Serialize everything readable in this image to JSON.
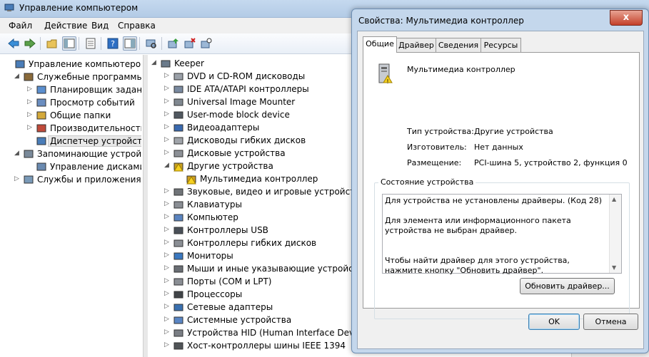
{
  "window": {
    "title": "Управление компьютером"
  },
  "menu": [
    "Файл",
    "Действие",
    "Вид",
    "Справка"
  ],
  "left_tree": [
    {
      "label": "Управление компьютером (л",
      "icon": "computer-management-icon"
    },
    {
      "label": "Служебные программы",
      "icon": "tools-icon"
    },
    {
      "label": "Планировщик заданий",
      "icon": "clock-icon"
    },
    {
      "label": "Просмотр событий",
      "icon": "event-viewer-icon"
    },
    {
      "label": "Общие папки",
      "icon": "shared-folder-icon"
    },
    {
      "label": "Производительность",
      "icon": "performance-icon"
    },
    {
      "label": "Диспетчер устройств",
      "icon": "device-manager-icon"
    },
    {
      "label": "Запоминающие устройст",
      "icon": "storage-icon"
    },
    {
      "label": "Управление дисками",
      "icon": "disk-management-icon"
    },
    {
      "label": "Службы и приложения",
      "icon": "services-icon"
    }
  ],
  "device_tree": {
    "root": "Keeper",
    "categories": [
      "DVD и CD-ROM дисководы",
      "IDE ATA/ATAPI контроллеры",
      "Universal Image Mounter",
      "User-mode block device",
      "Видеоадаптеры",
      "Дисководы гибких дисков",
      "Дисковые устройства",
      "Другие устройства",
      "Мультимедиа контроллер",
      "Звуковые, видео и игровые устройства",
      "Клавиатуры",
      "Компьютер",
      "Контроллеры USB",
      "Контроллеры гибких дисков",
      "Мониторы",
      "Мыши и иные указывающие устройства",
      "Порты (COM и LPT)",
      "Процессоры",
      "Сетевые адаптеры",
      "Системные устройства",
      "Устройства HID (Human Interface Devices)",
      "Хост-контроллеры шины IEEE 1394"
    ]
  },
  "dialog": {
    "title": "Свойства: Мультимедиа контроллер",
    "close": "x",
    "tabs": [
      "Общие",
      "Драйвер",
      "Сведения",
      "Ресурсы"
    ],
    "device_name": "Мультимедиа контроллер",
    "props": [
      {
        "label": "Тип устройства:",
        "value": "Другие устройства"
      },
      {
        "label": "Изготовитель:",
        "value": "Нет данных"
      },
      {
        "label": "Размещение:",
        "value": "PCI-шина 5, устройство 2, функция 0"
      }
    ],
    "status_title": "Состояние устройства",
    "status_text": "Для устройства не установлены драйверы. (Код 28)\n\nДля элемента или информационного пакета устройства не выбран драйвер.\n\n\nЧтобы найти драйвер для этого устройства, нажмите кнопку \"Обновить драйвер\".",
    "update_button": "Обновить драйвер...",
    "ok_button": "OK",
    "cancel_button": "Отмена"
  }
}
